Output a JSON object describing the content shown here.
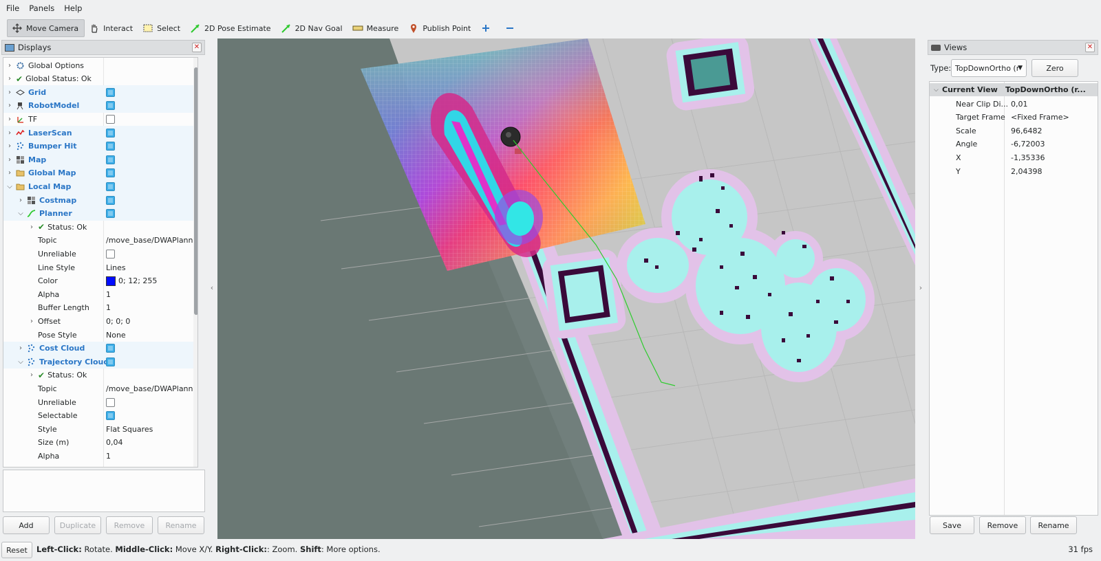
{
  "menu": [
    "File",
    "Panels",
    "Help"
  ],
  "toolbar": {
    "tools": [
      {
        "label": "Move Camera",
        "icon": "move-camera-icon",
        "active": true
      },
      {
        "label": "Interact",
        "icon": "hand-icon",
        "active": false
      },
      {
        "label": "Select",
        "icon": "select-icon",
        "active": false
      },
      {
        "label": "2D Pose Estimate",
        "icon": "pose-arrow-icon",
        "active": false
      },
      {
        "label": "2D Nav Goal",
        "icon": "nav-goal-arrow-icon",
        "active": false
      },
      {
        "label": "Measure",
        "icon": "ruler-icon",
        "active": false
      },
      {
        "label": "Publish Point",
        "icon": "map-pin-icon",
        "active": false
      }
    ],
    "add_icon": "plus-icon",
    "remove_icon": "minus-icon"
  },
  "displays": {
    "title": "Displays",
    "tree": [
      {
        "label": "Global Options",
        "icon": "gear",
        "indent": 0,
        "expander": "right",
        "style": "normal"
      },
      {
        "label": "Global Status: Ok",
        "icon": "check",
        "indent": 0,
        "expander": "right",
        "style": "normal"
      },
      {
        "label": "Grid",
        "icon": "grid",
        "indent": 0,
        "expander": "right",
        "style": "blue",
        "checkbox": true
      },
      {
        "label": "RobotModel",
        "icon": "robot",
        "indent": 0,
        "expander": "right",
        "style": "blue",
        "checkbox": true
      },
      {
        "label": "TF",
        "icon": "tf",
        "indent": 0,
        "expander": "right",
        "style": "normal",
        "checkbox": false
      },
      {
        "label": "LaserScan",
        "icon": "laser",
        "indent": 0,
        "expander": "right",
        "style": "blue",
        "checkbox": true
      },
      {
        "label": "Bumper Hit",
        "icon": "points",
        "indent": 0,
        "expander": "right",
        "style": "blue",
        "checkbox": true
      },
      {
        "label": "Map",
        "icon": "map",
        "indent": 0,
        "expander": "right",
        "style": "blue",
        "checkbox": true
      },
      {
        "label": "Global Map",
        "icon": "folder",
        "indent": 0,
        "expander": "right",
        "style": "blue",
        "checkbox": true
      },
      {
        "label": "Local Map",
        "icon": "folder",
        "indent": 0,
        "expander": "down",
        "style": "blue",
        "checkbox": true
      },
      {
        "label": "Costmap",
        "icon": "map",
        "indent": 1,
        "expander": "right",
        "style": "blue",
        "checkbox": true
      },
      {
        "label": "Planner",
        "icon": "path",
        "indent": 1,
        "expander": "down",
        "style": "blue",
        "checkbox": true
      },
      {
        "label": "Status: Ok",
        "icon": "check",
        "indent": 2,
        "expander": "right",
        "style": "normal"
      },
      {
        "label": "Topic",
        "indent": 2,
        "style": "normal",
        "value": "/move_base/DWAPlanner"
      },
      {
        "label": "Unreliable",
        "indent": 2,
        "style": "normal",
        "checkbox": false
      },
      {
        "label": "Line Style",
        "indent": 2,
        "style": "normal",
        "value": "Lines"
      },
      {
        "label": "Color",
        "indent": 2,
        "style": "normal",
        "value": "0; 12; 255",
        "swatch": "#000cff"
      },
      {
        "label": "Alpha",
        "indent": 2,
        "style": "normal",
        "value": "1"
      },
      {
        "label": "Buffer Length",
        "indent": 2,
        "style": "normal",
        "value": "1"
      },
      {
        "label": "Offset",
        "indent": 2,
        "expander": "right",
        "style": "normal",
        "value": "0; 0; 0"
      },
      {
        "label": "Pose Style",
        "indent": 2,
        "style": "normal",
        "value": "None"
      },
      {
        "label": "Cost Cloud",
        "icon": "points",
        "indent": 1,
        "expander": "right",
        "style": "blue",
        "checkbox": true
      },
      {
        "label": "Trajectory Cloud",
        "icon": "points",
        "indent": 1,
        "expander": "down",
        "style": "blue",
        "checkbox": true
      },
      {
        "label": "Status: Ok",
        "icon": "check",
        "indent": 2,
        "expander": "right",
        "style": "normal"
      },
      {
        "label": "Topic",
        "indent": 2,
        "style": "normal",
        "value": "/move_base/DWAPlanner"
      },
      {
        "label": "Unreliable",
        "indent": 2,
        "style": "normal",
        "checkbox": false
      },
      {
        "label": "Selectable",
        "indent": 2,
        "style": "normal",
        "checkbox": true
      },
      {
        "label": "Style",
        "indent": 2,
        "style": "normal",
        "value": "Flat Squares"
      },
      {
        "label": "Size (m)",
        "indent": 2,
        "style": "normal",
        "value": "0,04"
      },
      {
        "label": "Alpha",
        "indent": 2,
        "style": "normal",
        "value": "1"
      }
    ],
    "buttons": {
      "add": "Add",
      "duplicate": "Duplicate",
      "remove": "Remove",
      "rename": "Rename"
    }
  },
  "views": {
    "title": "Views",
    "type_label": "Type:",
    "type_value": "TopDownOrtho (r",
    "zero_label": "Zero",
    "header": {
      "key": "Current View",
      "value": "TopDownOrtho (r..."
    },
    "properties": [
      {
        "key": "Near Clip Di...",
        "value": "0,01"
      },
      {
        "key": "Target Frame",
        "value": "<Fixed Frame>"
      },
      {
        "key": "Scale",
        "value": "96,6482"
      },
      {
        "key": "Angle",
        "value": "-6,72003"
      },
      {
        "key": "X",
        "value": "-1,35336"
      },
      {
        "key": "Y",
        "value": "2,04398"
      }
    ],
    "buttons": {
      "save": "Save",
      "remove": "Remove",
      "rename": "Rename"
    }
  },
  "status": {
    "reset": "Reset",
    "hint_parts": [
      {
        "text": "Left-Click:",
        "bold": true
      },
      {
        "text": " Rotate. ",
        "bold": false
      },
      {
        "text": "Middle-Click:",
        "bold": true
      },
      {
        "text": " Move X/Y. ",
        "bold": false
      },
      {
        "text": "Right-Click:",
        "bold": true
      },
      {
        "text": ": Zoom. ",
        "bold": false
      },
      {
        "text": "Shift",
        "bold": true
      },
      {
        "text": ": More options.",
        "bold": false
      }
    ],
    "fps": "31 fps"
  },
  "colors": {
    "selection_blue": "#3daee9",
    "display_name_blue": "#2a76c6",
    "map_background": "#717f7c",
    "free_space": "#c8c8c8",
    "inflation_cyan": "#a8f0ec",
    "obstacle": "#3a0a3a",
    "plan_line": "#2ecc2e"
  }
}
